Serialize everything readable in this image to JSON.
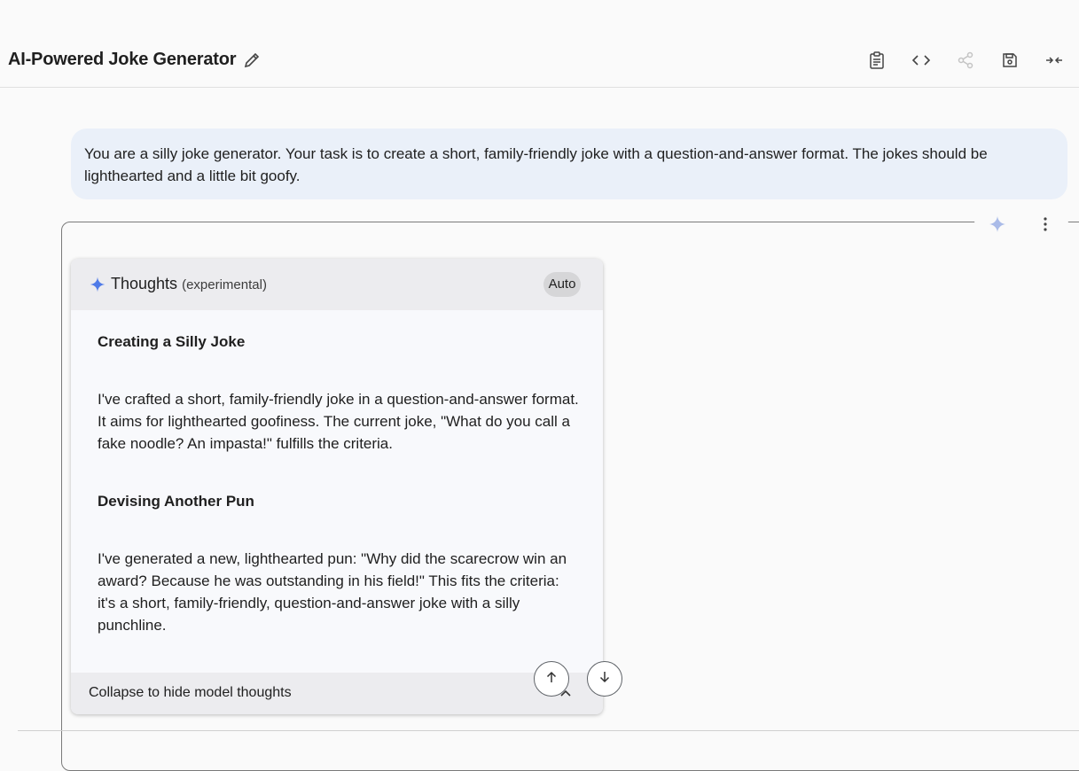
{
  "header": {
    "title": "AI-Powered Joke Generator",
    "toolbar": [
      {
        "name": "clipboard-icon"
      },
      {
        "name": "code-icon"
      },
      {
        "name": "share-icon"
      },
      {
        "name": "save-icon"
      },
      {
        "name": "collapse-arrows-icon"
      }
    ]
  },
  "prompt": {
    "text": "You are a silly joke generator. Your task is to create a short, family-friendly joke with a question-and-answer format. The jokes should be lighthearted and a little bit goofy."
  },
  "thoughts": {
    "title": "Thoughts",
    "subtitle": "(experimental)",
    "badge": "Auto",
    "sections": [
      {
        "heading": "Creating a Silly Joke",
        "body": "I've crafted a short, family-friendly joke in a question-and-answer format. It aims for lighthearted goofiness. The current joke, \"What do you call a fake noodle? An impasta!\" fulfills the criteria."
      },
      {
        "heading": "Devising Another Pun",
        "body": "I've generated a new, lighthearted pun: \"Why did the scarecrow win an award? Because he was outstanding in his field!\" This fits the criteria: it's a short, family-friendly, question-and-answer joke with a silly punchline."
      }
    ],
    "collapse_label": "Collapse to hide model thoughts"
  },
  "colors": {
    "accent": "#1a73e8",
    "prompt_bg": "#eaf0f9",
    "sparkle": "#4f7be8"
  }
}
